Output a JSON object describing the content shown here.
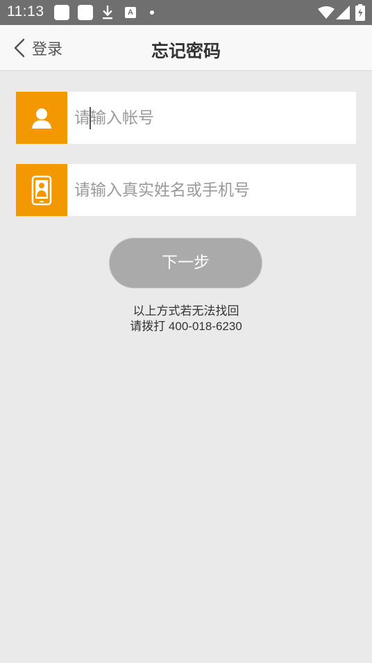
{
  "status_bar": {
    "time": "11:13",
    "notification_label": "A",
    "icons": [
      "app-notification-icon",
      "app-notification-icon",
      "download-icon",
      "a-icon",
      "dot-icon",
      "wifi-icon",
      "signal-icon",
      "battery-icon"
    ]
  },
  "header": {
    "back_label": "登录",
    "title": "忘记密码"
  },
  "form": {
    "account_placeholder": "请输入帐号",
    "name_phone_placeholder": "请输入真实姓名或手机号",
    "next_label": "下一步"
  },
  "help": {
    "line1": "以上方式若无法找回",
    "line2": "请拨打 400-018-6230"
  },
  "colors": {
    "accent": "#f39800",
    "button_disabled": "#aaaaaa",
    "background": "#eaeaea"
  }
}
